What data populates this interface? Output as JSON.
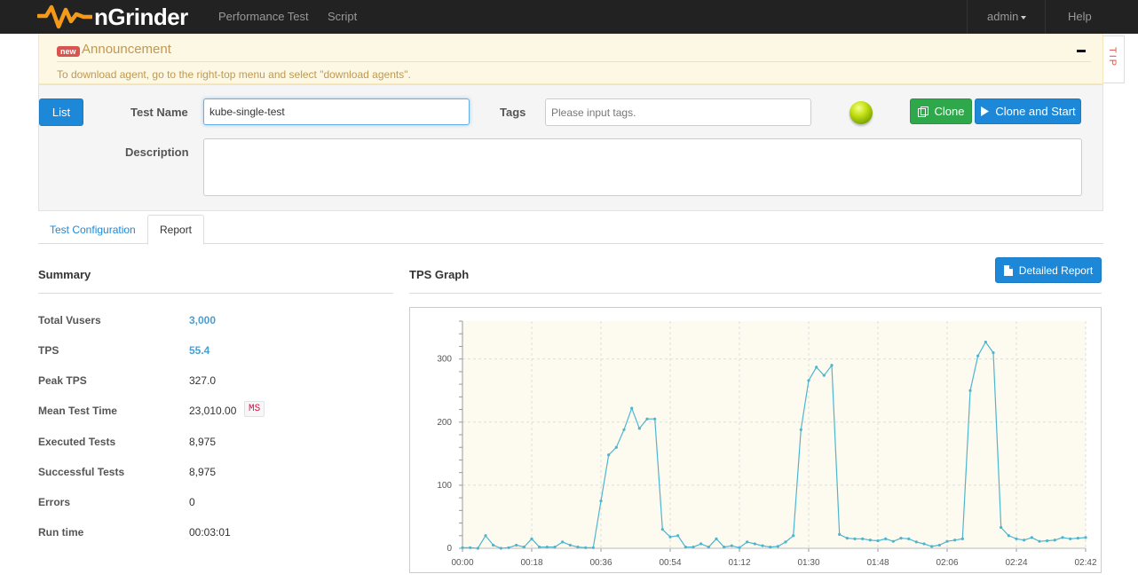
{
  "navbar": {
    "brand": "nGrinder",
    "links": [
      "Performance Test",
      "Script"
    ],
    "user": "admin",
    "help": "Help"
  },
  "announcement": {
    "badge": "new",
    "title": "Announcement",
    "text": "To download agent, go to the right-top menu and select \"download agents\".",
    "tip": "TIP"
  },
  "form": {
    "list_button": "List",
    "test_name_label": "Test Name",
    "test_name_value": "kube-single-test",
    "tags_label": "Tags",
    "tags_placeholder": "Please input tags.",
    "description_label": "Description",
    "description_value": "",
    "clone_button": "Clone",
    "clone_start_button": "Clone and Start",
    "status_color": "#9ccc00"
  },
  "tabs": [
    {
      "label": "Test Configuration",
      "active": false
    },
    {
      "label": "Report",
      "active": true
    }
  ],
  "summary": {
    "title": "Summary",
    "rows": [
      {
        "label": "Total Vusers",
        "value": "3,000",
        "link": true
      },
      {
        "label": "TPS",
        "value": "55.4",
        "link": true
      },
      {
        "label": "Peak TPS",
        "value": "327.0"
      },
      {
        "label": "Mean Test Time",
        "value": "23,010.00",
        "unit": "MS"
      },
      {
        "label": "Executed Tests",
        "value": "8,975"
      },
      {
        "label": "Successful Tests",
        "value": "8,975"
      },
      {
        "label": "Errors",
        "value": "0"
      },
      {
        "label": "Run time",
        "value": "00:03:01"
      }
    ]
  },
  "tps": {
    "title": "TPS Graph",
    "detailed_report_button": "Detailed Report"
  },
  "colors": {
    "primary": "#1d88d8",
    "success": "#2ea84a",
    "chart_line": "#4eb5cf",
    "chart_bg": "#fdfbf0"
  },
  "chart_data": {
    "type": "line",
    "title": "",
    "xlabel": "",
    "ylabel": "",
    "xtick_labels": [
      "00:00",
      "00:18",
      "00:36",
      "00:54",
      "01:12",
      "01:30",
      "01:48",
      "02:06",
      "02:24",
      "02:42"
    ],
    "ytick_labels": [
      "0",
      "100",
      "200",
      "300"
    ],
    "ylim": [
      0,
      360
    ],
    "xlim": [
      0,
      162
    ],
    "grid": true,
    "series": [
      {
        "x": [
          0,
          2,
          4,
          6,
          8,
          10,
          12,
          14,
          16,
          18,
          20,
          22,
          24,
          26,
          28,
          30,
          32,
          34,
          36,
          38,
          40,
          42,
          44,
          46,
          48,
          50,
          52,
          54,
          56,
          58,
          60,
          62,
          64,
          66,
          68,
          70,
          72,
          74,
          76,
          78,
          80,
          82,
          84,
          86,
          88,
          90,
          92,
          94,
          96,
          98,
          100,
          102,
          104,
          106,
          108,
          110,
          112,
          114,
          116,
          118,
          120,
          122,
          124,
          126,
          128,
          130,
          132,
          134,
          136,
          138,
          140,
          142,
          144,
          146,
          148,
          150,
          152,
          154,
          156,
          158,
          160,
          162
        ],
        "values": [
          1,
          1,
          0,
          20,
          5,
          0,
          1,
          5,
          2,
          15,
          2,
          2,
          2,
          10,
          5,
          2,
          1,
          1,
          75,
          148,
          160,
          188,
          222,
          190,
          205,
          205,
          30,
          18,
          20,
          2,
          2,
          7,
          2,
          15,
          2,
          4,
          1,
          10,
          7,
          4,
          2,
          3,
          10,
          20,
          188,
          266,
          287,
          274,
          290,
          22,
          16,
          15,
          15,
          13,
          12,
          15,
          11,
          16,
          15,
          10,
          7,
          3,
          5,
          11,
          13,
          15,
          250,
          305,
          327,
          310,
          33,
          20,
          15,
          13,
          17,
          11,
          12,
          13,
          17,
          15,
          16,
          17
        ]
      }
    ]
  }
}
